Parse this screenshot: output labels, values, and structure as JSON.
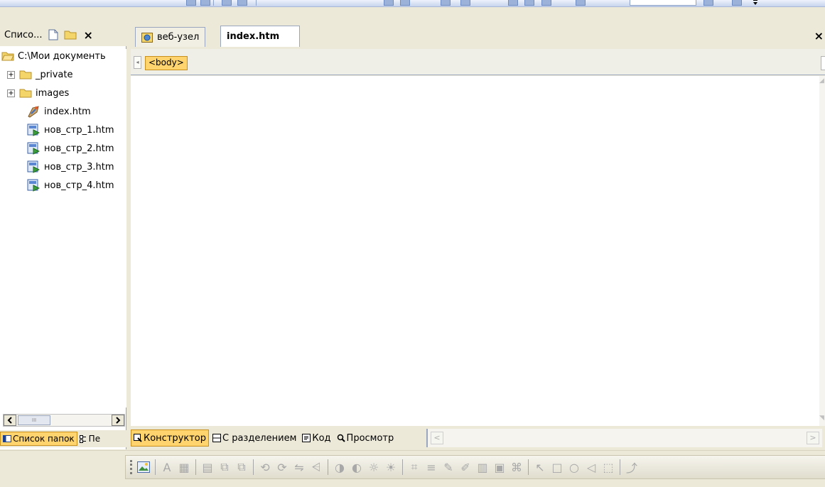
{
  "left_panel": {
    "title": "Списо...",
    "close_glyph": "×",
    "tree": [
      {
        "label": "C:\\Мои документь",
        "icon": "open-folder-icon",
        "level": 0
      },
      {
        "label": "_private",
        "icon": "folder-icon",
        "level": 1,
        "expander": "+"
      },
      {
        "label": "images",
        "icon": "folder-icon",
        "level": 1,
        "expander": "+"
      },
      {
        "label": "index.htm",
        "icon": "home-page-icon",
        "level": 1
      },
      {
        "label": "нов_стр_1.htm",
        "icon": "html-file-icon",
        "level": 1
      },
      {
        "label": "нов_стр_2.htm",
        "icon": "html-file-icon",
        "level": 1
      },
      {
        "label": "нов_стр_3.htm",
        "icon": "html-file-icon",
        "level": 1
      },
      {
        "label": "нов_стр_4.htm",
        "icon": "html-file-icon",
        "level": 1
      }
    ],
    "bottom_tabs": {
      "folders_label": "Список папок",
      "navigation_label": "Пе"
    },
    "scroll_thumb_label": "III"
  },
  "editor": {
    "tabs": [
      {
        "label": "веб-узел",
        "icon": "website-icon"
      },
      {
        "label": "index.htm",
        "active": true
      }
    ],
    "close_glyph": "×",
    "quick_tag": "<body>"
  },
  "view_bar": {
    "design_label": "Конструктор",
    "split_label": "С разделением",
    "code_label": "Код",
    "preview_label": "Просмотр"
  },
  "colors": {
    "chrome": "#ece9d8",
    "active_highlight": "#ffd36e",
    "active_border": "#c88f1b",
    "folder_yellow": "#f4d56a",
    "panel_border": "#9aa6bd"
  }
}
